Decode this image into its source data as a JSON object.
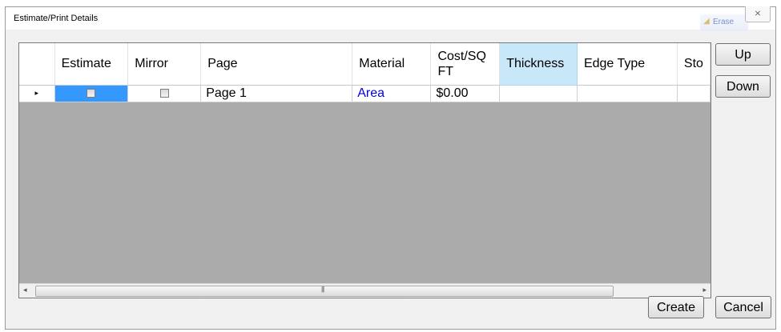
{
  "window": {
    "title": "Estimate/Print Details",
    "background_ghost_label": "Erase",
    "close_label": "⨯"
  },
  "grid": {
    "columns": [
      "Estimate",
      "Mirror",
      "Page",
      "Material",
      "Cost/SQ FT",
      "Thickness",
      "Edge Type",
      "Sto"
    ],
    "selected_column": "Thickness",
    "rows": [
      {
        "indicator": "▸",
        "estimate_checked": false,
        "mirror_checked": false,
        "page": "Page 1",
        "material": "Area",
        "cost": "$0.00",
        "thickness": "",
        "edge_type": "",
        "sto": ""
      }
    ],
    "scrollbar": {
      "left_arrow": "◂",
      "right_arrow": "▸",
      "grip": "|||"
    }
  },
  "buttons": {
    "up": "Up",
    "down": "Down",
    "create": "Create",
    "cancel": "Cancel"
  },
  "colors": {
    "current_cell": "#3399ff",
    "selected_header": "#c8e7f9",
    "empty_area": "#ababab",
    "link_text": "#0000ee"
  }
}
